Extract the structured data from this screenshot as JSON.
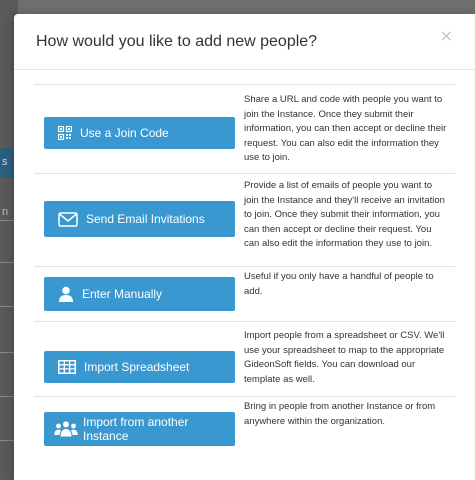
{
  "modal": {
    "title": "How would you like to add new people?",
    "close_label": "×"
  },
  "backdrop": {
    "char_s": "s",
    "char_n": "n"
  },
  "options": [
    {
      "label": "Use a Join Code",
      "icon": "qr-code-icon",
      "description": "Share a URL and code with people you want to join the Instance. Once they submit their information, you can then accept or decline their request. You can also edit the information they use to join."
    },
    {
      "label": "Send Email Invitations",
      "icon": "envelope-icon",
      "description": "Provide a list of emails of people you want to join the Instance and they'll receive an invitation to join. Once they submit their information, you can then accept or decline their request. You can also edit the information they use to join."
    },
    {
      "label": "Enter Manually",
      "icon": "user-icon",
      "description": "Useful if you only have a handful of people to add."
    },
    {
      "label": "Import Spreadsheet",
      "icon": "table-icon",
      "description": "Import people from a spreadsheet or CSV. We'll use your spreadsheet to map to the appropriate GideonSoft fields. You can download our template as well."
    },
    {
      "label": "Import from another Instance",
      "icon": "users-group-icon",
      "description": "Bring in people from another Instance or from anywhere within the organization."
    }
  ],
  "colors": {
    "button": "#3a98d1",
    "overlay": "#6f6f6f"
  }
}
